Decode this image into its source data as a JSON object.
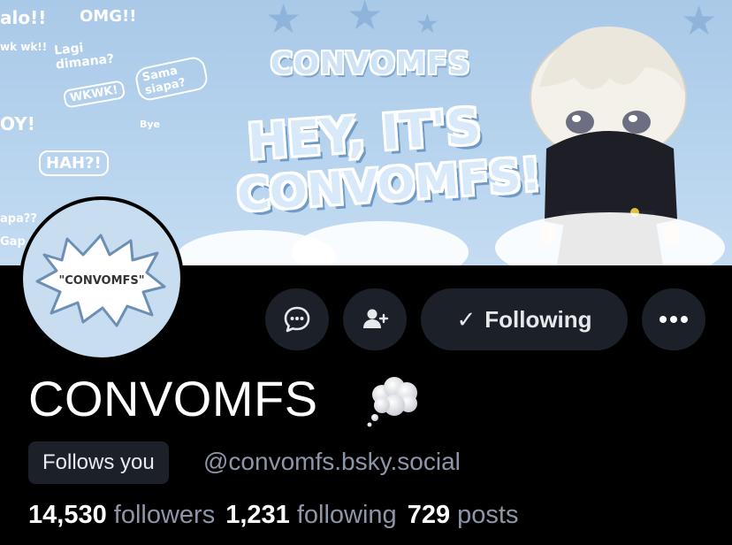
{
  "banner": {
    "logo_text": "CONVOMFS",
    "headline_line1": "HEY, IT'S",
    "headline_line2": "CONVOMFS!",
    "doodles": [
      "alo!!",
      "OMG!!",
      "Lagi dimana?",
      "Sama siapa?",
      "WKWK!",
      "HAH?!",
      "OY!",
      "wk wk!!",
      "Bye",
      "apa??",
      "Gap"
    ]
  },
  "avatar": {
    "text": "\"CONVOMFS\""
  },
  "actions": {
    "following_label": "Following"
  },
  "profile": {
    "display_name": "CONVOMFS",
    "follows_you": "Follows you",
    "handle": "@convomfs.bsky.social"
  },
  "stats": {
    "followers_count": "14,530",
    "followers_label": "followers",
    "following_count": "1,231",
    "following_label": "following",
    "posts_count": "729",
    "posts_label": "posts"
  },
  "colors": {
    "background": "#000000",
    "button_bg": "#1c2028",
    "muted_text": "#8d96a8",
    "banner_blue": "#b8d4ee"
  },
  "icons": [
    "chat-bubble-icon",
    "add-user-icon",
    "checkmark-icon",
    "more-dots-icon",
    "thought-bubble-icon"
  ]
}
